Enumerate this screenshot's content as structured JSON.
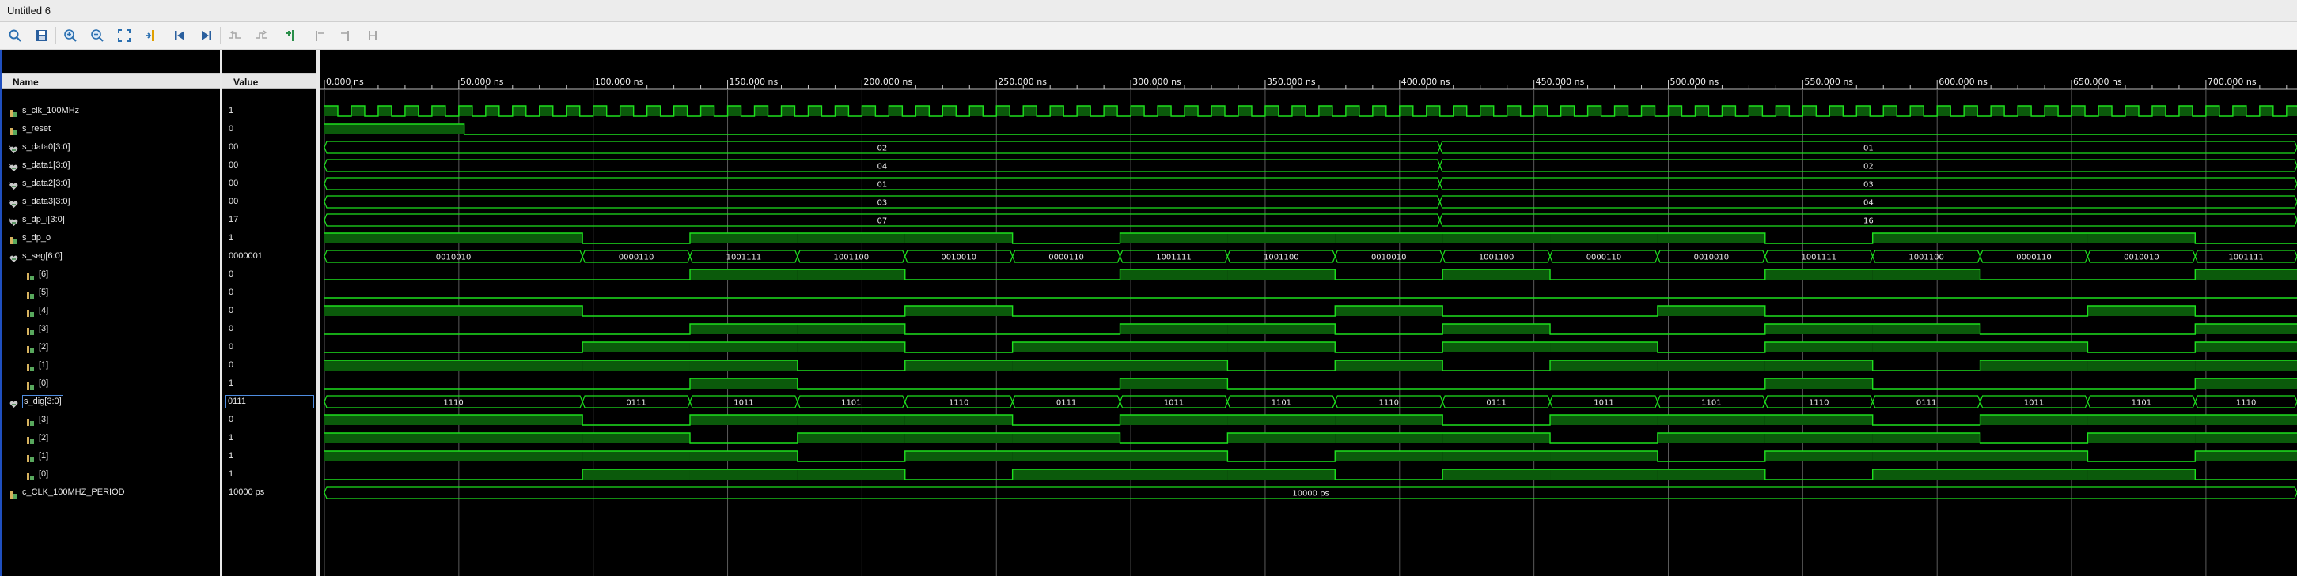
{
  "window": {
    "title": "Untitled 6"
  },
  "toolbar": {
    "buttons": [
      {
        "name": "search-icon"
      },
      {
        "name": "save-icon"
      },
      {
        "name": "zoom-in-icon"
      },
      {
        "name": "zoom-out-icon"
      },
      {
        "name": "zoom-fit-icon"
      },
      {
        "name": "go-to-cursor-icon"
      },
      {
        "name": "go-to-time-zero-icon"
      },
      {
        "name": "go-to-last-time-icon"
      },
      {
        "name": "previous-transition-icon"
      },
      {
        "name": "next-transition-icon"
      },
      {
        "name": "add-marker-icon"
      },
      {
        "name": "previous-marker-icon"
      },
      {
        "name": "next-marker-icon"
      },
      {
        "name": "swap-cursors-icon"
      }
    ]
  },
  "columns": {
    "name": "Name",
    "value": "Value"
  },
  "signals": [
    {
      "name": "s_clk_100MHz",
      "value": "1",
      "icon": "bit-icon",
      "expand": "",
      "indent": 0
    },
    {
      "name": "s_reset",
      "value": "0",
      "icon": "bit-icon",
      "expand": "",
      "indent": 0
    },
    {
      "name": "s_data0[3:0]",
      "value": "00",
      "icon": "bus-icon",
      "expand": "›",
      "indent": 0
    },
    {
      "name": "s_data1[3:0]",
      "value": "00",
      "icon": "bus-icon",
      "expand": "›",
      "indent": 0
    },
    {
      "name": "s_data2[3:0]",
      "value": "00",
      "icon": "bus-icon",
      "expand": "›",
      "indent": 0
    },
    {
      "name": "s_data3[3:0]",
      "value": "00",
      "icon": "bus-icon",
      "expand": "›",
      "indent": 0
    },
    {
      "name": "s_dp_i[3:0]",
      "value": "17",
      "icon": "bus-icon",
      "expand": "›",
      "indent": 0
    },
    {
      "name": "s_dp_o",
      "value": "1",
      "icon": "bit-icon",
      "expand": "",
      "indent": 0
    },
    {
      "name": "s_seg[6:0]",
      "value": "0000001",
      "icon": "bus-icon",
      "expand": "⌄",
      "indent": 0
    },
    {
      "name": "[6]",
      "value": "0",
      "icon": "bit-icon",
      "expand": "",
      "indent": 1
    },
    {
      "name": "[5]",
      "value": "0",
      "icon": "bit-icon",
      "expand": "",
      "indent": 1
    },
    {
      "name": "[4]",
      "value": "0",
      "icon": "bit-icon",
      "expand": "",
      "indent": 1
    },
    {
      "name": "[3]",
      "value": "0",
      "icon": "bit-icon",
      "expand": "",
      "indent": 1
    },
    {
      "name": "[2]",
      "value": "0",
      "icon": "bit-icon",
      "expand": "",
      "indent": 1
    },
    {
      "name": "[1]",
      "value": "0",
      "icon": "bit-icon",
      "expand": "",
      "indent": 1
    },
    {
      "name": "[0]",
      "value": "1",
      "icon": "bit-icon",
      "expand": "",
      "indent": 1
    },
    {
      "name": "s_dig[3:0]",
      "value": "0111",
      "icon": "bus-icon",
      "expand": "⌄",
      "indent": 0,
      "selected": true
    },
    {
      "name": "[3]",
      "value": "0",
      "icon": "bit-icon",
      "expand": "",
      "indent": 1
    },
    {
      "name": "[2]",
      "value": "1",
      "icon": "bit-icon",
      "expand": "",
      "indent": 1
    },
    {
      "name": "[1]",
      "value": "1",
      "icon": "bit-icon",
      "expand": "",
      "indent": 1
    },
    {
      "name": "[0]",
      "value": "1",
      "icon": "bit-icon",
      "expand": "",
      "indent": 1
    },
    {
      "name": "c_CLK_100MHZ_PERIOD",
      "value": "10000 ps",
      "icon": "bit-icon",
      "expand": "",
      "indent": 0
    }
  ],
  "timeline": {
    "unit": "ns",
    "range_ns": [
      0,
      735
    ],
    "tick_step_ns": 50,
    "tick_labels": [
      "0.000 ns",
      "50.000 ns",
      "100.000 ns",
      "150.000 ns",
      "200.000 ns",
      "250.000 ns",
      "300.000 ns",
      "350.000 ns",
      "400.000 ns",
      "450.000 ns",
      "500.000 ns",
      "550.000 ns",
      "600.000 ns",
      "650.000 ns",
      "700.000 ns"
    ]
  },
  "waves": {
    "clock": {
      "period_ns": 10
    },
    "reset": {
      "high_until_ns": 52
    },
    "bus_change_ns": 415,
    "s_data0": [
      "02",
      "01"
    ],
    "s_data1": [
      "04",
      "02"
    ],
    "s_data2": [
      "01",
      "03"
    ],
    "s_data3": [
      "03",
      "04"
    ],
    "s_dp_i": [
      "07",
      "16"
    ],
    "digit_edges_ns": [
      0,
      96,
      136,
      176,
      216,
      256,
      296,
      336,
      376,
      416,
      456,
      496,
      536,
      576,
      616,
      656,
      696,
      736
    ],
    "s_dig": [
      "1110",
      "0111",
      "1011",
      "1101",
      "1110",
      "0111",
      "1011",
      "1101",
      "1110",
      "0111",
      "1011",
      "1101",
      "1110",
      "0111",
      "1011",
      "1101",
      "1110"
    ],
    "s_seg": [
      "0010010",
      "0000110",
      "1001111",
      "1001100",
      "0010010",
      "0000110",
      "1001111",
      "1001100",
      "0010010",
      "1001100",
      "0000110",
      "0010010",
      "1001111",
      "1001100",
      "0000110",
      "0010010",
      "1001111"
    ],
    "s_dp_o": [
      "1",
      "0",
      "1",
      "1",
      "1",
      "0",
      "1",
      "1",
      "1",
      "1",
      "1",
      "1",
      "0",
      "1",
      "1",
      "1",
      "0"
    ],
    "period_const": "10000 ps"
  }
}
